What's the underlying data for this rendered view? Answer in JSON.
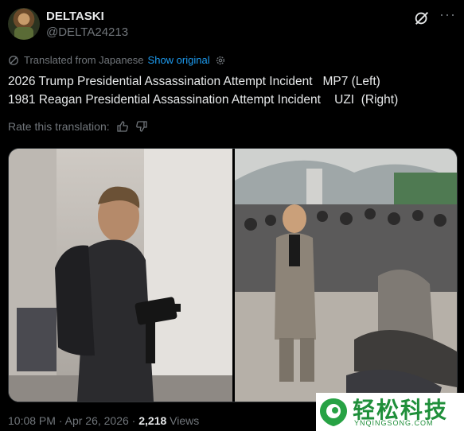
{
  "author": {
    "display_name": "DELTASKI",
    "handle": "@DELTA24213"
  },
  "translation": {
    "label": "Translated from Japanese",
    "show_original": "Show original"
  },
  "tweet": {
    "line1": "2026 Trump Presidential Assassination Attempt Incident   MP7 (Left)",
    "line2": "1981 Reagan Presidential Assassination Attempt Incident    UZI  (Right)"
  },
  "rate": {
    "label": "Rate this translation:"
  },
  "footer": {
    "time": "10:08 PM",
    "sep1": " · ",
    "date": "Apr 26, 2026",
    "sep2": " · ",
    "views": "2,218",
    "views_label": " Views"
  },
  "watermark": {
    "title": "轻松科技",
    "subtitle": "YNQINGSONG.COM"
  },
  "icons": {
    "grok": "grok-icon",
    "more": "more-icon",
    "globe": "translate-icon",
    "gear": "settings-icon",
    "thumb_up": "thumb-up-icon",
    "thumb_down": "thumb-down-icon"
  },
  "colors": {
    "background": "#000000",
    "text": "#e7e9ea",
    "muted": "#71767b",
    "link": "#1d9bf0",
    "watermark_green": "#1f8f3a"
  }
}
